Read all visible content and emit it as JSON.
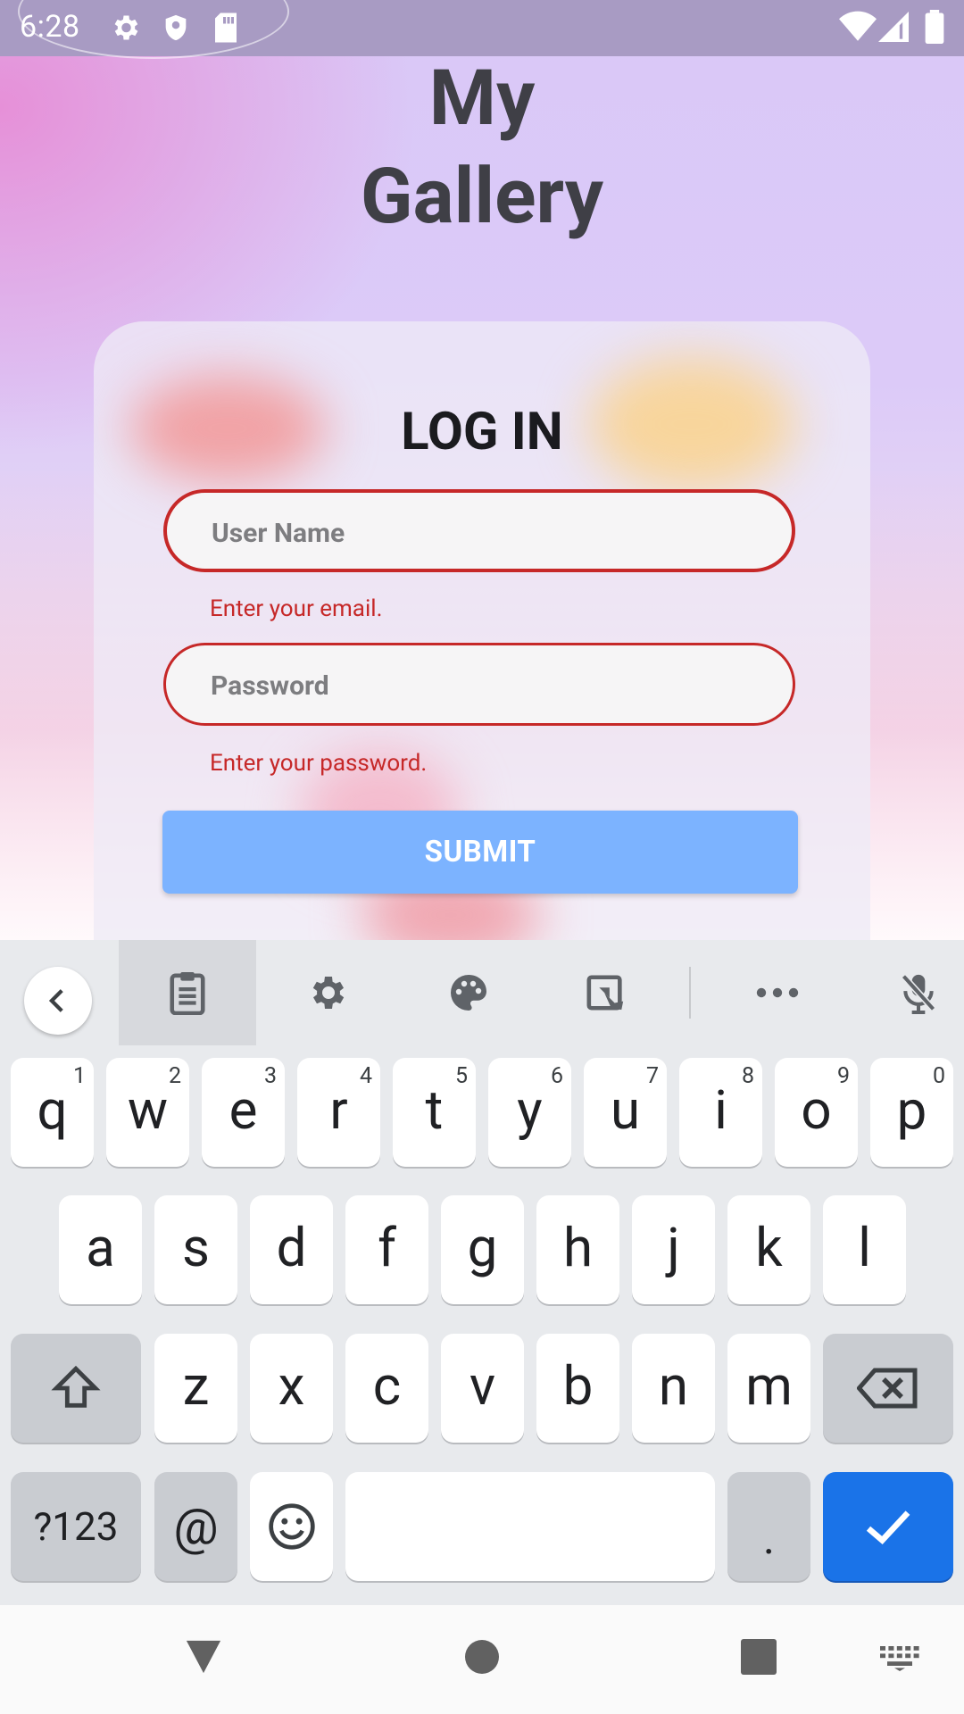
{
  "status_bar": {
    "time": "6:28"
  },
  "app": {
    "title_line1": "My",
    "title_line2": "Gallery",
    "login_title": "LOG IN",
    "username": {
      "placeholder": "User Name",
      "error": "Enter your email."
    },
    "password": {
      "placeholder": "Password",
      "error": "Enter your password."
    },
    "submit_label": "SUBMIT"
  },
  "keyboard": {
    "row1": [
      {
        "key": "q",
        "hint": "1"
      },
      {
        "key": "w",
        "hint": "2"
      },
      {
        "key": "e",
        "hint": "3"
      },
      {
        "key": "r",
        "hint": "4"
      },
      {
        "key": "t",
        "hint": "5"
      },
      {
        "key": "y",
        "hint": "6"
      },
      {
        "key": "u",
        "hint": "7"
      },
      {
        "key": "i",
        "hint": "8"
      },
      {
        "key": "o",
        "hint": "9"
      },
      {
        "key": "p",
        "hint": "0"
      }
    ],
    "row2": [
      "a",
      "s",
      "d",
      "f",
      "g",
      "h",
      "j",
      "k",
      "l"
    ],
    "row3": [
      "z",
      "x",
      "c",
      "v",
      "b",
      "n",
      "m"
    ],
    "symbols_label": "?123",
    "at_label": "@",
    "period_label": "."
  },
  "colors": {
    "accent": "#7cb3ff",
    "error": "#c62828",
    "keyboard_enter": "#1a73e8"
  }
}
